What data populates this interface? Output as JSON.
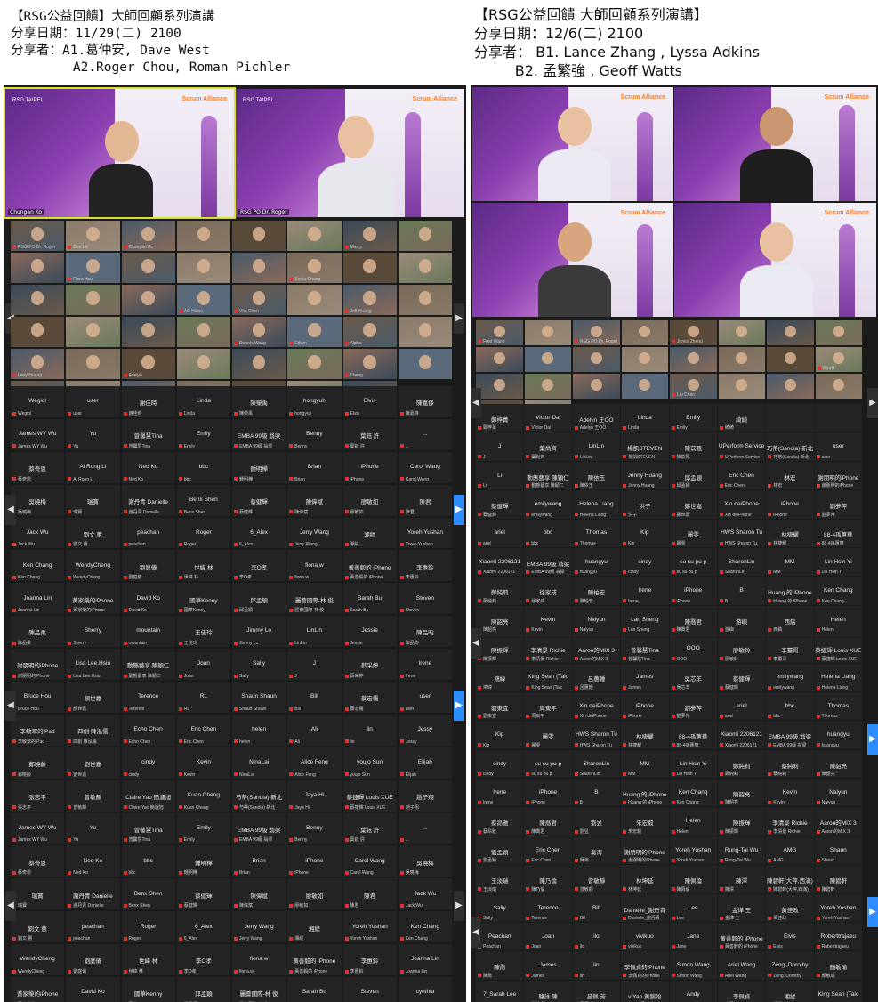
{
  "left_header": {
    "line1": "【RSG公益回饋】大師回顧系列演講",
    "line2": "分享日期：11/29(二) 2100",
    "line3": "分享者：A1.葛仲安, Dave West",
    "line4": "        A2.Roger Chou, Roman Pichler"
  },
  "right_header": {
    "line1": "【RSG公益回饋 大師回顧系列演講】",
    "line2": "分享日期：12/6(二) 2100",
    "line3": "分享者： B1. Lance Zhang , Lyssa Adkins",
    "line4": "         B2. 孟繁強 , Geoff Watts"
  },
  "left_speakers": [
    {
      "label": "Chungan Ko"
    },
    {
      "label": "RSG PO Dr. Roger"
    }
  ],
  "right_speakers": [
    {
      "label": ""
    },
    {
      "label": ""
    },
    {
      "label": ""
    },
    {
      "label": ""
    }
  ],
  "left_video_labels": [
    "RSG PO Dr. Roger",
    "Dee Lin",
    "Chungan Ko",
    "",
    "",
    "",
    "Marcy",
    "",
    "",
    "Flora Hsu",
    "",
    "",
    "",
    "Sonia Chang",
    "",
    "",
    "",
    "",
    "",
    "AC Hsiao",
    "Vita Chen",
    "",
    "Jeff Huang",
    "",
    "",
    "",
    "",
    "",
    "Dennis Wang",
    "Edwin",
    "Alpha",
    "",
    "Leny Huang",
    "",
    "Adelyn",
    "",
    "",
    "",
    "Sheng",
    "",
    "",
    "",
    "",
    "",
    "Eddie Tsai",
    "Eddie Chen",
    ""
  ],
  "left_name_rows": [
    [
      "Wegiol",
      "user",
      "謝佳時",
      "Linda",
      "陳榮禹",
      "hongyuh",
      "Elvis",
      "陳嘉鋒"
    ],
    [
      "James WY Wu",
      "Yu",
      "曾馨慧Tina",
      "Emily",
      "EMBA 99級 翁梁",
      "Benny",
      "葉鈺 許",
      "..."
    ],
    [
      "蔡奇恩",
      "Ai Rong Li",
      "Ned Ko",
      "bbc",
      "鍾明樺",
      "Brian",
      "iPhone",
      "Carol Wang"
    ],
    [
      "吳曉梅",
      "瑞寶",
      "謝丹青 Danielle",
      "Benx Shen",
      "蔡健輝",
      "陳偉斌",
      "廖敏如",
      "陳君"
    ],
    [
      "Jack Wu",
      "劉文 蕙",
      "peachan",
      "Roger",
      "6_Alex",
      "Jerry Wang",
      "湘緹",
      "Yoreh Yushan"
    ],
    [
      "Ken Chang",
      "WendyCheng",
      "劉庭儀",
      "世緯 林",
      "李O孝",
      "fiona.w",
      "黃善毅的 iPhone",
      "李惠鈴"
    ],
    [
      "Joanna Lin",
      "黃家榮的iPhone",
      "David Ko",
      "國華Kenny",
      "邱孟穎",
      "麗薈國際-林 俊",
      "Sarah Bu",
      "Steven"
    ],
    [
      "陳品柔",
      "Sherry",
      "mountain",
      "王佳玲",
      "Jimmy Lo",
      "LinLin",
      "Jessie",
      "陳品昀"
    ],
    [
      "謝朋明的iPhone",
      "Lisa Lee.Hsiu",
      "動態藝享 陳穎仁",
      "Joan",
      "Sally",
      "J",
      "蔡采婷",
      "Irene"
    ],
    [
      "Bruce Hou",
      "顏世嘉",
      "Terence",
      "RL",
      "Shaun Shaun",
      "Bill",
      "蔡宏儒",
      "user"
    ],
    [
      "李敏翠的iPad",
      "四創 陳泓儒",
      "Echo Chen",
      "Eric Chen",
      "helen",
      "Ali",
      "lin",
      "Jessy"
    ],
    [
      "鄭曉齡",
      "劉世嘉",
      "cindy",
      "Kevin",
      "NinaLai",
      "Alice Feng",
      "youjo Sun",
      "Elijah"
    ],
    [
      "張志平",
      "曾敏靜",
      "Claire Yao 簡濾旭",
      "Kuan Cheng",
      "芍蒂(Sandia) 新北",
      "Jaya Hi",
      "蔡捷輝 Louis XUE",
      "趙子翔"
    ],
    [
      "James WY Wu",
      "Yu",
      "曾馨慧Tina",
      "Emily",
      "EMBA 99級 翁梁",
      "Benny",
      "葉鈺 許",
      "..."
    ],
    [
      "蔡奇恩",
      "Ned Ko",
      "bbc",
      "鍾明樺",
      "Brian",
      "iPhone",
      "Carol Wang",
      "吳曉梅"
    ],
    [
      "瑞寶",
      "謝丹青 Danielle",
      "Benx Shen",
      "蔡健輝",
      "陳偉斌",
      "廖敏如",
      "陳君",
      "Jack Wu"
    ],
    [
      "劉文 蕙",
      "peachan",
      "Roger",
      "6_Alex",
      "Jerry Wang",
      "湘緹",
      "Yoreh Yushan",
      "Ken Chang"
    ],
    [
      "WendyCheng",
      "劉庭儀",
      "世緯 林",
      "李O孝",
      "fiona.w",
      "黃善毅的 iPhone",
      "李惠鈴",
      "Joanna Lin"
    ],
    [
      "黃家榮的iPhone",
      "David Ko",
      "國華Kenny",
      "邱孟穎",
      "麗薈國際-林 俊",
      "Sarah Bu",
      "Steven",
      "cynthia"
    ]
  ],
  "right_video_labels": [
    "Fred Wang",
    "",
    "RSG PO Dr. Roger",
    "",
    "Jones Zheng",
    "",
    "",
    "",
    "",
    "",
    "",
    "",
    "",
    "",
    "",
    "Wyatt",
    "",
    "",
    "",
    "",
    "Liu Chen",
    "",
    "",
    "",
    "",
    ""
  ],
  "right_name_rows": [
    [
      "鄭梓菁",
      "Victor Dai",
      "Adelyn 王OO",
      "Linda",
      "Emily",
      "綺綺",
      "",
      ""
    ],
    [
      "J",
      "葉尚齊",
      "LinLin",
      "楊凱STEVEN",
      "陳苡甄",
      "UPerform Service",
      "巧蒂(Sandia) 新北",
      "user"
    ],
    [
      "Li",
      "動態藝享 陳穎仁",
      "陳依玉",
      "Jenny Huang",
      "邱孟穎",
      "Eric Chen",
      "林宏",
      "謝朋明的iPhone"
    ],
    [
      "蔡健輝",
      "emilywang",
      "Helena Liang",
      "洪子",
      "鄭世嘉",
      "Xin deiPhone",
      "iPhone",
      "劉夢萍"
    ],
    [
      "ariel",
      "bbc",
      "Thomas",
      "Kip",
      "麗雯",
      "HWS Sharon Tu",
      "林捷耀",
      "88-4孫蕙華"
    ],
    [
      "Xiaomi 2206121",
      "EMBA 99級 翁梁",
      "huangyu",
      "cindy",
      "su su pu p",
      "SharonLin",
      "MM",
      "Lin Hsin Yi"
    ],
    [
      "鄭純莉",
      "徐家成",
      "陳柏宏",
      "Irene",
      "iPhone",
      "B",
      "Huang 的 iPhone",
      "Ken Chang"
    ],
    [
      "陳韶亮",
      "Kevin",
      "Naiyun",
      "Lan Sheng",
      "陳喬君",
      "游嶼",
      "西鎬",
      "Helen"
    ],
    [
      "陳振輝",
      "李清景 Richie",
      "Aaron的MIX 3",
      "曾馨慧Tina",
      "OOO",
      "廖敏鈴",
      "李薑哥",
      "蔡捷輝 Louis XUE"
    ],
    [
      "鴻緯",
      "King Sean (Taic",
      "呂蕙鍾",
      "James",
      "吳芯羊",
      "蔡健輝",
      "emilywang",
      "Helena Liang"
    ],
    [
      "劉東宜",
      "周東平",
      "Xin deiPhone",
      "iPhone",
      "劉夢萍",
      "ariel",
      "bbc",
      "Thomas"
    ],
    [
      "Kip",
      "麗雯",
      "HWS Sharon Tu",
      "林捷耀",
      "88-4孫蕙華",
      "Xiaomi 2206121",
      "EMBA 99級 翁梁",
      "huangyu"
    ],
    [
      "cindy",
      "su su pu p",
      "SharonLin",
      "MM",
      "Lin Hsin Yi",
      "鄭純莉",
      "蔡純莉",
      "陳韶亮"
    ],
    [
      "Irene",
      "iPhone",
      "B",
      "Huang 的 iPhone",
      "Ken Chang",
      "陳韶亮",
      "Kevin",
      "Naiyun"
    ],
    [
      "蔡昂雅",
      "陳喬君",
      "劉昱",
      "朱宏毅",
      "Helen",
      "陳振輝",
      "李清景 Richie",
      "Aaron的MIX 3"
    ],
    [
      "劉孟穎",
      "Eric Chen",
      "吳海",
      "謝朋明的iPhone",
      "Yoreh Yushan",
      "Rung-Tai Wu",
      "AMG",
      "Shaun"
    ],
    [
      "王淡瑞",
      "陳乃倫",
      "曾敏靜",
      "林坤延",
      "陳佩倫",
      "陳澤",
      "陳碧軒(大萍,西滿)",
      "陳碧軒"
    ],
    [
      "Sally",
      "Terence",
      "Bill",
      "Danielle_謝丹青",
      "Lee",
      "金燁 王",
      "黃佳政",
      "Yoreh Yushan"
    ],
    [
      "Peachan",
      "Joan",
      "ilo",
      "vivikuo",
      "Jane",
      "黃善毅的 iPhone",
      "Elvis",
      "Roberttrajaeu"
    ],
    [
      "陳喬",
      "James",
      "lin",
      "李佩貞的iPhone",
      "Simon Wang",
      "Ariel Wang",
      "Zeng. Dorothy",
      "顏敏瑜"
    ],
    [
      "7_Sarah Lee",
      "駱詠 陳",
      "呂佩 芳",
      "v Yao 黃錦始",
      "Andy",
      "李佩貞",
      "湘緹",
      "King Sean (Taic"
    ]
  ],
  "colors": {
    "panel_bg": "#1b1b1b",
    "cell_bg": "#242424",
    "active_speaker": "#d8e030",
    "nav_blue": "#2d8cff",
    "mic_red": "#dd3333"
  }
}
